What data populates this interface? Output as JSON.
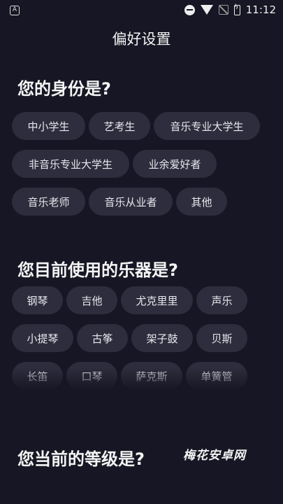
{
  "status_bar": {
    "time": "11:12",
    "left_icon": "A"
  },
  "header": {
    "title": "偏好设置"
  },
  "sections": {
    "identity": {
      "title": "您的身份是?",
      "options": [
        "中小学生",
        "艺考生",
        "音乐专业大学生",
        "非音乐专业大学生",
        "业余爱好者",
        "音乐老师",
        "音乐从业者",
        "其他"
      ]
    },
    "instrument": {
      "title": "您目前使用的乐器是?",
      "options": [
        "钢琴",
        "吉他",
        "尤克里里",
        "声乐",
        "小提琴",
        "古筝",
        "架子鼓",
        "贝斯",
        "长笛",
        "口琴",
        "萨克斯",
        "单簧管"
      ]
    },
    "level": {
      "title": "您当前的等级是?"
    }
  },
  "watermark": "梅花安卓网",
  "colors": {
    "background": "#161624",
    "chip": "#2d2d3d",
    "text": "#e8e8ee"
  }
}
